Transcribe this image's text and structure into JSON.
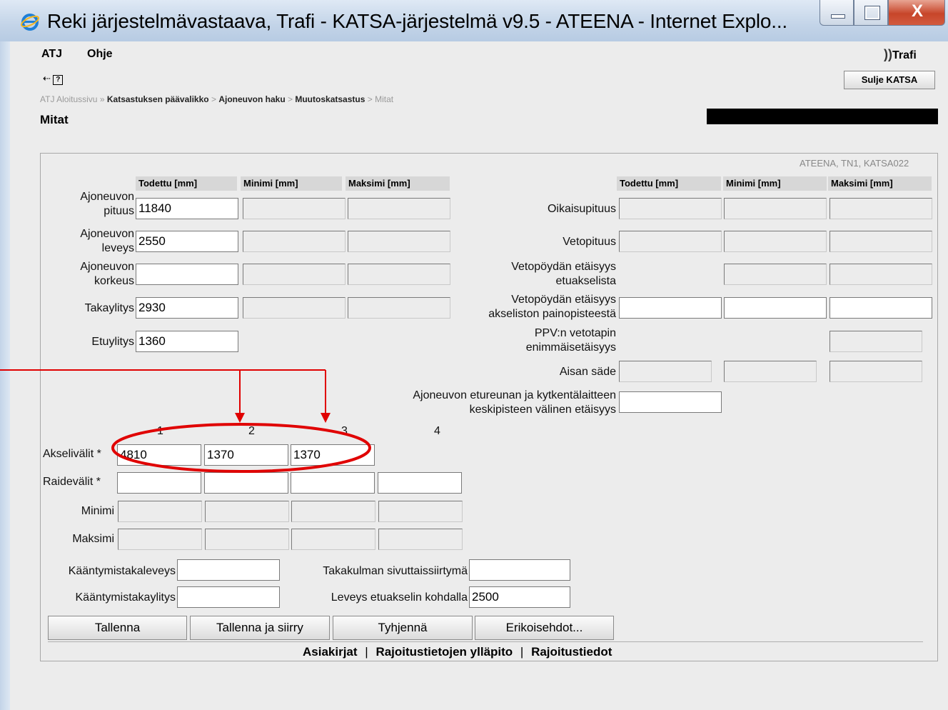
{
  "window": {
    "title": "Reki järjestelmävastaava, Trafi - KATSA-järjestelmä v9.5 - ATEENA - Internet Explo...",
    "close_glyph": "X"
  },
  "menu": {
    "items": [
      "ATJ",
      "Ohje"
    ]
  },
  "brand": {
    "logo_text": "Trafi"
  },
  "toolbar": {
    "back_icon": "back-arrow-icon",
    "help_icon": "help-icon",
    "help_glyph": "?",
    "close_label": "Sulje KATSA"
  },
  "breadcrumb": {
    "items": [
      "ATJ Aloitussivu",
      "Katsastuksen päävalikko",
      "Ajoneuvon haku",
      "Muutoskatsastus",
      "Mitat"
    ],
    "sep1": "»",
    "sep": ">"
  },
  "page_title": "Mitat",
  "sysinfo": "ATEENA, TN1, KATSA022",
  "headers": {
    "todettu": "Todettu [mm]",
    "minimi": "Minimi [mm]",
    "maksimi": "Maksimi [mm]"
  },
  "left_rows": [
    {
      "label1": "Ajoneuvon",
      "label2": "pituus",
      "value": "11840"
    },
    {
      "label1": "Ajoneuvon",
      "label2": "leveys",
      "value": "2550"
    },
    {
      "label1": "Ajoneuvon",
      "label2": "korkeus",
      "value": ""
    },
    {
      "label1": "Takaylitys",
      "label2": "",
      "value": "2930"
    },
    {
      "label1": "Etuylitys",
      "label2": "",
      "value": "1360"
    }
  ],
  "right_rows": [
    {
      "label1": "Oikaisupituus",
      "label2": ""
    },
    {
      "label1": "Vetopituus",
      "label2": ""
    },
    {
      "label1": "Vetopöydän etäisyys",
      "label2": "etuakselista"
    },
    {
      "label1": "Vetopöydän etäisyys",
      "label2": "akseliston painopisteestä"
    },
    {
      "label1": "PPV:n vetotapin",
      "label2": "enimmäisetäisyys"
    },
    {
      "label1": "Aisan säde",
      "label2": ""
    },
    {
      "label1": "Ajoneuvon etureunan ja kytkentälaitteen",
      "label2": "keskipisteen välinen etäisyys"
    }
  ],
  "axle": {
    "numbers": [
      "1",
      "2",
      "3",
      "4"
    ],
    "akselivalit_label": "Akselivälit *",
    "akselivalit_values": [
      "4810",
      "1370",
      "1370"
    ],
    "raidevalit_label": "Raidevälit *",
    "minimi_label": "Minimi",
    "maksimi_label": "Maksimi"
  },
  "bottom": {
    "kaantymistakaleveys_label": "Kääntymistakaleveys",
    "kaantymistakaylitys_label": "Kääntymistakaylitys",
    "takakulman_label": "Takakulman sivuttaissiirtymä",
    "leveys_etuakseli_label": "Leveys etuakselin kohdalla",
    "leveys_etuakseli_value": "2500"
  },
  "buttons": [
    "Tallenna",
    "Tallenna ja siirry",
    "Tyhjennä",
    "Erikoisehdot..."
  ],
  "links": [
    "Asiakirjat",
    "Rajoitustietojen ylläpito",
    "Rajoitustiedot"
  ],
  "link_sep": "|",
  "annotation": {
    "color": "#e00000"
  }
}
